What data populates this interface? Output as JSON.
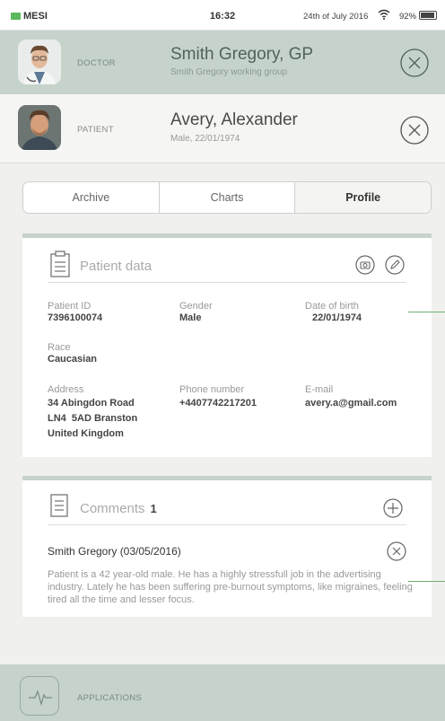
{
  "status_bar": {
    "carrier": "MESI",
    "time": "16:32",
    "date": "24th of July 2016",
    "battery_percent": "92%",
    "battery_level": 0.92
  },
  "doctor": {
    "role": "DOCTOR",
    "name": "Smith Gregory, GP",
    "group": "Smith Gregory working group"
  },
  "patient": {
    "role": "PATIENT",
    "name": "Avery, Alexander",
    "details": "Male, 22/01/1974"
  },
  "tabs": [
    {
      "label": "Archive",
      "active": false
    },
    {
      "label": "Charts",
      "active": false
    },
    {
      "label": "Profile",
      "active": true
    }
  ],
  "patient_data": {
    "title": "Patient data",
    "fields": {
      "patient_id": {
        "label": "Patient ID",
        "value": "7396100074"
      },
      "gender": {
        "label": "Gender",
        "value": "Male"
      },
      "dob": {
        "label": "Date of birth",
        "value": "22/01/1974"
      },
      "race": {
        "label": "Race",
        "value": "Caucasian"
      },
      "address": {
        "label": "Address",
        "line1": "34 Abingdon Road",
        "line2": "LN4  5AD Branston",
        "line3": "United Kingdom"
      },
      "phone": {
        "label": "Phone number",
        "value": "+4407742217201"
      },
      "email": {
        "label": "E-mail",
        "value": "avery.a@gmail.com"
      }
    }
  },
  "comments": {
    "title": "Comments",
    "count": "1",
    "items": [
      {
        "author": "Smith Gregory (03/05/2016)",
        "text": "Patient is a 42 year-old male. He has a highly stressfull job in the advertising industry. Lately he has been suffering pre-burnout symptoms, like migraines, feeling tired all the time and lesser focus."
      }
    ]
  },
  "bottom_bar": {
    "label": "APPLICATIONS"
  },
  "colors": {
    "accent": "#c5d3cb",
    "pointer": "#6fb06f",
    "battery_charging": "#5cb85c"
  }
}
